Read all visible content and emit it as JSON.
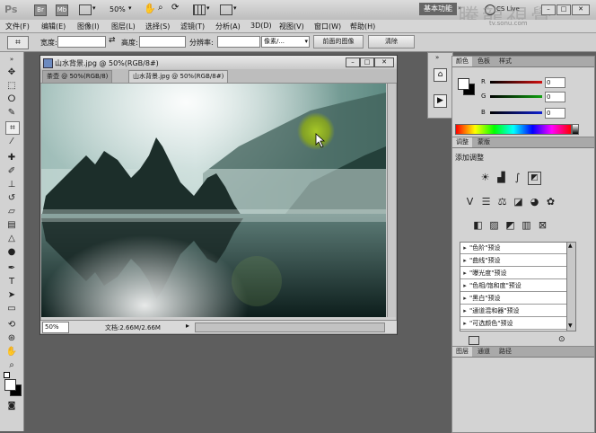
{
  "app": {
    "logo": "Ps",
    "zoom": "50%",
    "workspace_label": "基本功能",
    "watermark_cn": "騰龍視覺",
    "watermark_url": "tv.sonu.com",
    "cs_live_label": "CS Live"
  },
  "menubar": [
    "文件(F)",
    "编辑(E)",
    "图像(I)",
    "图层(L)",
    "选择(S)",
    "滤镜(T)",
    "分析(A)",
    "3D(D)",
    "视图(V)",
    "窗口(W)",
    "帮助(H)"
  ],
  "options": {
    "width_label": "宽度:",
    "height_label": "高度:",
    "resolution_label": "分辨率:",
    "unit_value": "像素/...",
    "front_image_button": "前面的图像",
    "clear_button": "清除"
  },
  "document": {
    "title": "山水背景.jpg @ 50%(RGB/8#)",
    "tabs": [
      "茶壶 @ 50%(RGB/8)",
      "山水背景.jpg @ 50%(RGB/8#)"
    ],
    "zoom_field": "50%",
    "doc_info": "文档:2.66M/2.66M"
  },
  "color_panel": {
    "tabs": [
      "颜色",
      "色板",
      "样式"
    ],
    "channels": [
      {
        "label": "R",
        "value": "0",
        "color": "#d01010"
      },
      {
        "label": "G",
        "value": "0",
        "color": "#10a010"
      },
      {
        "label": "B",
        "value": "0",
        "color": "#1020d0"
      }
    ]
  },
  "adjust_panel": {
    "tabs": [
      "调整",
      "蒙版"
    ],
    "heading": "添加调整",
    "icon_rows": [
      [
        "brightness-icon",
        "levels-icon",
        "curves-icon",
        "exposure-icon"
      ],
      [
        "vibrance-icon",
        "hue-saturation-icon",
        "color-balance-icon",
        "black-white-icon",
        "photo-filter-icon",
        "channel-mixer-icon"
      ],
      [
        "invert-icon",
        "posterize-icon",
        "threshold-icon",
        "gradient-map-icon",
        "selective-color-icon"
      ]
    ],
    "presets": [
      "\"色阶\"预设",
      "\"曲线\"预设",
      "\"曝光度\"预设",
      "\"色相/饱和度\"预设",
      "\"黑白\"预设",
      "\"通道混和器\"预设",
      "\"可选颜色\"预设"
    ]
  },
  "layers_panel": {
    "tabs": [
      "图层",
      "通道",
      "路径"
    ]
  }
}
